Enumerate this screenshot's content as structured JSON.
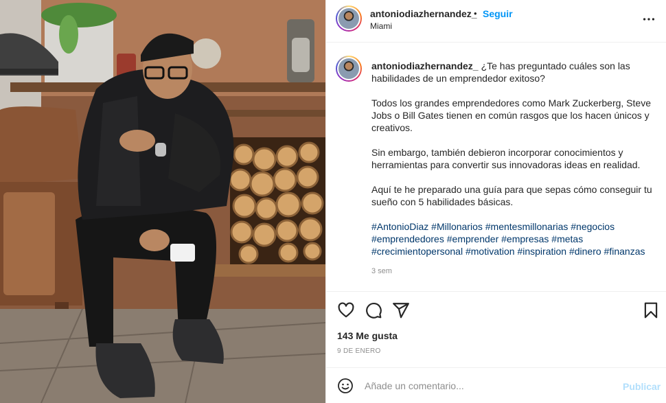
{
  "post": {
    "username": "antoniodiazhernandez_",
    "separator": "•",
    "follow_label": "Seguir",
    "location": "Miami",
    "more_icon": "more-horizontal-icon"
  },
  "caption": {
    "username": "antoniodiazhernandez_",
    "intro": "¿Te has preguntado cuáles son las habilidades de un emprendedor exitoso?",
    "paragraphs": [
      "Todos los grandes emprendedores como Mark Zuckerberg, Steve Jobs o Bill Gates tienen en común rasgos que los hacen únicos y creativos.",
      "Sin embargo, también debieron incorporar conocimientos y herramientas para convertir sus innovadoras ideas en realidad.",
      "Aquí te he preparado una guía para que sepas cómo conseguir tu sueño con 5 habilidades básicas."
    ],
    "hashtags": [
      "#AntonioDiaz",
      "#Millonarios",
      "#mentesmillonarias",
      "#negocios",
      "#emprendedores",
      "#emprender",
      "#empresas",
      "#metas",
      "#crecimientopersonal",
      "#motivation",
      "#inspiration",
      "#dinero",
      "#finanzas"
    ],
    "time_ago": "3 sem"
  },
  "actions": {
    "icons": [
      "heart-icon",
      "comment-icon",
      "share-icon",
      "bookmark-icon"
    ]
  },
  "likes": "143 Me gusta",
  "date": "9 DE ENERO",
  "comment": {
    "placeholder": "Añade un comentario...",
    "publish_label": "Publicar",
    "emoji_icon": "emoji-icon"
  },
  "colors": {
    "link_blue": "#0095f6",
    "hashtag": "#00376b",
    "muted": "#8e8e8e",
    "publish_disabled": "#b2dffc",
    "border": "#efefef"
  }
}
